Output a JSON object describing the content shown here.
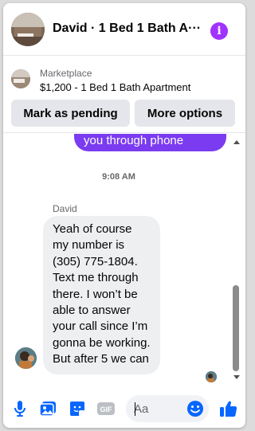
{
  "header": {
    "title": "David · 1 Bed 1 Bath A···",
    "info_icon": "info-icon",
    "avatar_icon": "apartment-photo"
  },
  "listing": {
    "source": "Marketplace",
    "title": "$1,200 - 1 Bed 1 Bath Apartment",
    "mark_pending_label": "Mark as pending",
    "more_options_label": "More options"
  },
  "conversation": {
    "outgoing_tail": "you through phone",
    "timestamp": "9:08 AM",
    "sender_name": "David",
    "incoming_message": "Yeah of course my number is (305) 775-1804. Text me through there. I won’t be able to answer your call since I’m gonna be working. But after 5 we can"
  },
  "composer": {
    "placeholder": "Aa",
    "value": "",
    "icons": [
      "microphone-icon",
      "photo-icon",
      "sticker-icon",
      "gif-icon",
      "emoji-icon",
      "thumbs-up-icon"
    ]
  },
  "colors": {
    "accent": "#0866ff",
    "outgoing_bubble": "#7b3bf0",
    "info_icon": "#a033ff",
    "incoming_bubble": "#eeeff1"
  }
}
